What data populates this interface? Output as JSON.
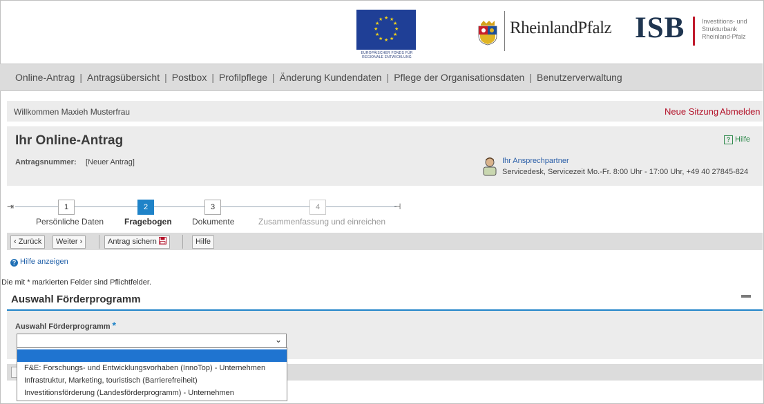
{
  "header": {
    "eu_logo_text": "EUROPÄISCHER FONDS FÜR REGIONALE ENTWICKLUNG",
    "state_logo_text": "RheinlandPfalz",
    "isb_logo_text": "ISB",
    "isb_subtitle": "Investitions- und Strukturbank Rheinland-Pfalz"
  },
  "main_nav": {
    "items": [
      "Online-Antrag",
      "Antragsübersicht",
      "Postbox",
      "Profilpflege",
      "Änderung Kundendaten",
      "Pflege der Organisationsdaten",
      "Benutzerverwaltung"
    ],
    "separator": "|"
  },
  "welcome_bar": {
    "welcome_text": "Willkommen Maxieh Musterfrau",
    "new_session": "Neue Sitzung",
    "logout": "Abmelden"
  },
  "antrag": {
    "title": "Ihr Online-Antrag",
    "help_label": "Hilfe",
    "number_label": "Antragsnummer:",
    "number_value": "[Neuer Antrag]",
    "contact_title": "Ihr Ansprechpartner",
    "contact_detail": "Servicedesk, Servicezeit Mo.-Fr. 8:00 Uhr - 17:00 Uhr, +49 40 27845-824"
  },
  "stepper": {
    "current_step": 2,
    "steps": [
      {
        "number": "1",
        "label": "Persönliche Daten",
        "state": "done"
      },
      {
        "number": "2",
        "label": "Fragebogen",
        "state": "active"
      },
      {
        "number": "3",
        "label": "Dokumente",
        "state": "done"
      },
      {
        "number": "4",
        "label": "Zusammenfassung und einreichen",
        "state": "disabled"
      }
    ]
  },
  "toolbar": {
    "back_label": "‹ Zurück",
    "next_label": "Weiter ›",
    "save_label": "Antrag sichern",
    "help_label": "Hilfe"
  },
  "form": {
    "show_help": "Hilfe anzeigen",
    "required_note": "Die mit * markierten Felder sind Pflichtfelder.",
    "section_title": "Auswahl Förderprogramm",
    "field_label": "Auswahl Förderprogramm",
    "required_marker": "*",
    "select_value": "",
    "options": [
      "",
      "F&E: Forschungs- und Entwicklungsvorhaben (InnoTop) - Unternehmen",
      "Infrastruktur, Marketing, touristisch (Barrierefreiheit)",
      "Investitionsförderung (Landesförderprogramm) - Unternehmen"
    ]
  },
  "colors": {
    "accent_blue": "#1f83c8",
    "dropdown_highlight": "#1f74d0",
    "link_red": "#b3132a",
    "help_green": "#2f8a4c",
    "isb_red": "#c01a2c",
    "eu_blue": "#1f3f96"
  }
}
